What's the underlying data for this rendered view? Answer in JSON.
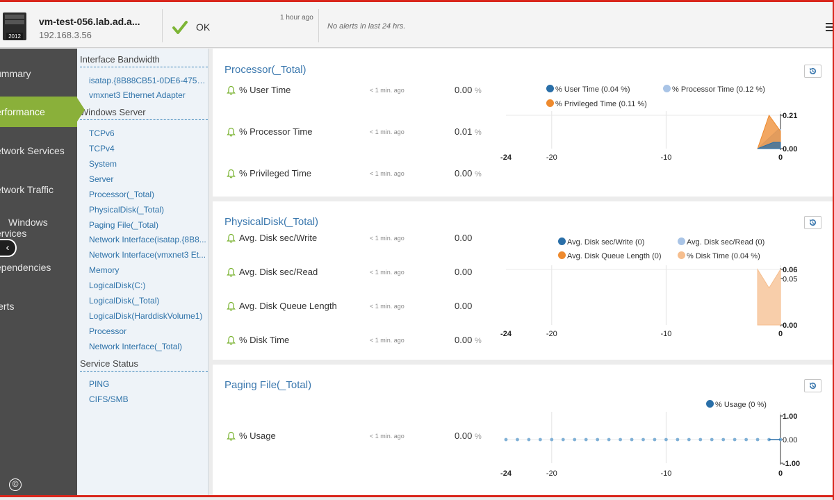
{
  "header": {
    "host_name": "vm-test-056.lab.ad.a...",
    "host_ip": "192.168.3.56",
    "host_badge": "2012",
    "status_text": "OK",
    "status_time": "1 hour ago",
    "alerts_text": "No alerts in last 24 hrs."
  },
  "leftnav": {
    "items": [
      {
        "label": "ummary"
      },
      {
        "label": "erformance"
      },
      {
        "label": "etwork Services"
      },
      {
        "label": "etwork Traffic"
      },
      {
        "label": "Windows",
        "label2": "ervices"
      },
      {
        "label": "ependencies"
      },
      {
        "label": "lerts"
      }
    ],
    "active_index": 1
  },
  "subnav": {
    "sections": [
      {
        "title": "Interface Bandwidth",
        "links": [
          "isatap.{8B88CB51-0DE6-475C-...",
          "vmxnet3 Ethernet Adapter"
        ]
      },
      {
        "title": "Windows Server",
        "links": [
          "TCPv6",
          "TCPv4",
          "System",
          "Server",
          "Processor(_Total)",
          "PhysicalDisk(_Total)",
          "Paging File(_Total)",
          "Network Interface(isatap.{8B8...",
          "Network Interface(vmxnet3 Et...",
          "Memory",
          "LogicalDisk(C:)",
          "LogicalDisk(_Total)",
          "LogicalDisk(HarddiskVolume1)",
          "Processor",
          "Network Interface(_Total)"
        ]
      },
      {
        "title": "Service Status",
        "links": [
          "PING",
          "CIFS/SMB"
        ]
      }
    ]
  },
  "panels": [
    {
      "title": "Processor(_Total)",
      "metrics": [
        {
          "name": "% User Time",
          "age": "< 1 min. ago",
          "value": "0.00",
          "unit": "%"
        },
        {
          "name": "% Processor Time",
          "age": "< 1 min. ago",
          "value": "0.01",
          "unit": "%"
        },
        {
          "name": "% Privileged Time",
          "age": "< 1 min. ago",
          "value": "0.00",
          "unit": "%"
        }
      ],
      "legend": [
        {
          "label": "% User Time (0.04 %)",
          "color": "#2a6fa8"
        },
        {
          "label": "% Processor Time (0.12 %)",
          "color": "#a9c4e6"
        },
        {
          "label": "% Privileged Time (0.11 %)",
          "color": "#ee8a2e"
        }
      ]
    },
    {
      "title": "PhysicalDisk(_Total)",
      "metrics": [
        {
          "name": "Avg. Disk sec/Write",
          "age": "< 1 min. ago",
          "value": "0.00",
          "unit": ""
        },
        {
          "name": "Avg. Disk sec/Read",
          "age": "< 1 min. ago",
          "value": "0.00",
          "unit": ""
        },
        {
          "name": "Avg. Disk Queue Length",
          "age": "< 1 min. ago",
          "value": "0.00",
          "unit": ""
        },
        {
          "name": "% Disk Time",
          "age": "< 1 min. ago",
          "value": "0.00",
          "unit": "%"
        }
      ],
      "legend": [
        {
          "label": "Avg. Disk sec/Write (0)",
          "color": "#2a6fa8"
        },
        {
          "label": "Avg. Disk sec/Read (0)",
          "color": "#a9c4e6"
        },
        {
          "label": "Avg. Disk Queue Length (0)",
          "color": "#ee8a2e"
        },
        {
          "label": "% Disk Time (0.04 %)",
          "color": "#f6be8e"
        }
      ]
    },
    {
      "title": "Paging File(_Total)",
      "metrics": [
        {
          "name": "% Usage",
          "age": "< 1 min. ago",
          "value": "0.00",
          "unit": "%"
        }
      ],
      "legend": [
        {
          "label": "% Usage (0 %)",
          "color": "#2a6fa8"
        }
      ]
    }
  ],
  "chart_data": [
    {
      "type": "area",
      "x_ticks": [
        "-24",
        "-20",
        "-10",
        "0"
      ],
      "y_ticks": [
        "0.21",
        "0.00"
      ],
      "xlim": [
        -24,
        0
      ],
      "ylim": [
        0,
        0.21
      ],
      "series": [
        {
          "name": "% Processor Time",
          "color": "#a9c4e6",
          "x": [
            -2,
            -0.2,
            0
          ],
          "values": [
            0,
            0.12,
            0.12
          ]
        },
        {
          "name": "% Privileged Time",
          "color": "#ee8a2e",
          "x": [
            -2,
            -1,
            0
          ],
          "values": [
            0,
            0.21,
            0.11
          ]
        },
        {
          "name": "% User Time",
          "color": "#2a6fa8",
          "x": [
            -2,
            -0.6,
            0
          ],
          "values": [
            0,
            0.04,
            0.04
          ]
        }
      ]
    },
    {
      "type": "area",
      "x_ticks": [
        "-24",
        "-20",
        "-10",
        "0"
      ],
      "y_ticks": [
        "0.06",
        "0.05",
        "0.00"
      ],
      "xlim": [
        -24,
        0
      ],
      "ylim": [
        0,
        0.06
      ],
      "series": [
        {
          "name": "% Disk Time",
          "color": "#f6be8e",
          "x": [
            -2,
            -1,
            0
          ],
          "values": [
            0.06,
            0.04,
            0.06
          ]
        }
      ]
    },
    {
      "type": "line",
      "x_ticks": [
        "-24",
        "-20",
        "-10",
        "0"
      ],
      "y_ticks": [
        "1.00",
        "0.00",
        "-1.00"
      ],
      "xlim": [
        -24,
        0
      ],
      "ylim": [
        -1,
        1
      ],
      "series": [
        {
          "name": "% Usage",
          "color": "#7fb0d6",
          "x": [
            -24,
            -23,
            -22,
            -21,
            -20,
            -19,
            -18,
            -17,
            -16,
            -15,
            -14,
            -13,
            -12,
            -11,
            -10,
            -9,
            -8,
            -7,
            -6,
            -5,
            -4,
            -3,
            -2,
            -1,
            0
          ],
          "values": [
            0,
            0,
            0,
            0,
            0,
            0,
            0,
            0,
            0,
            0,
            0,
            0,
            0,
            0,
            0,
            0,
            0,
            0,
            0,
            0,
            0,
            0,
            0,
            0,
            0
          ]
        }
      ]
    }
  ]
}
